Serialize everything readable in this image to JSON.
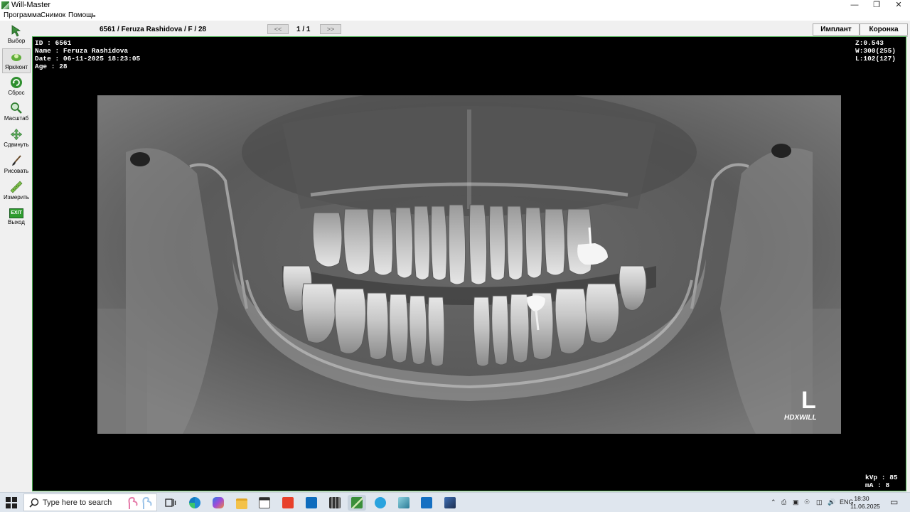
{
  "window": {
    "title": "Will-Master"
  },
  "menu": [
    "Программа",
    "Снимок",
    "Помощь"
  ],
  "toolbar": [
    {
      "label": "Выбор",
      "icon": "arrow-cursor-icon"
    },
    {
      "label": "Ярк/конт",
      "icon": "brightness-contrast-icon"
    },
    {
      "label": "Сброс",
      "icon": "reset-icon"
    },
    {
      "label": "Масштаб",
      "icon": "magnifier-icon"
    },
    {
      "label": "Сдвинуть",
      "icon": "move-arrows-icon"
    },
    {
      "label": "Рисовать",
      "icon": "brush-icon"
    },
    {
      "label": "Измерить",
      "icon": "ruler-icon"
    },
    {
      "label": "Выход",
      "icon": "exit-icon",
      "badge": "EXIT"
    }
  ],
  "header": {
    "patient": "6561 / Feruza Rashidova / F / 28",
    "prev": "<<",
    "page": "1 / 1",
    "next": ">>",
    "implant_button": "Имплант",
    "crown_button": "Коронка"
  },
  "overlay": {
    "left": [
      "ID : 6561",
      "Name : Feruza Rashidova",
      "Date : 06-11-2025 18:23:05",
      "Age : 28"
    ],
    "right": [
      "Z:0.543",
      "W:300(255)",
      "L:102(127)"
    ],
    "bottom_right": [
      "kVp : 85",
      "mA : 8"
    ],
    "side_marker": "L",
    "watermark": "HDXWILL"
  },
  "taskbar": {
    "search_placeholder": "Type here to search",
    "language": "ENG",
    "time": "18:30",
    "date": "11.06.2025"
  },
  "colors": {
    "viewer_border": "#4caf50",
    "viewer_bg": "#000000",
    "taskbar_bg": "#dfe6ee"
  }
}
